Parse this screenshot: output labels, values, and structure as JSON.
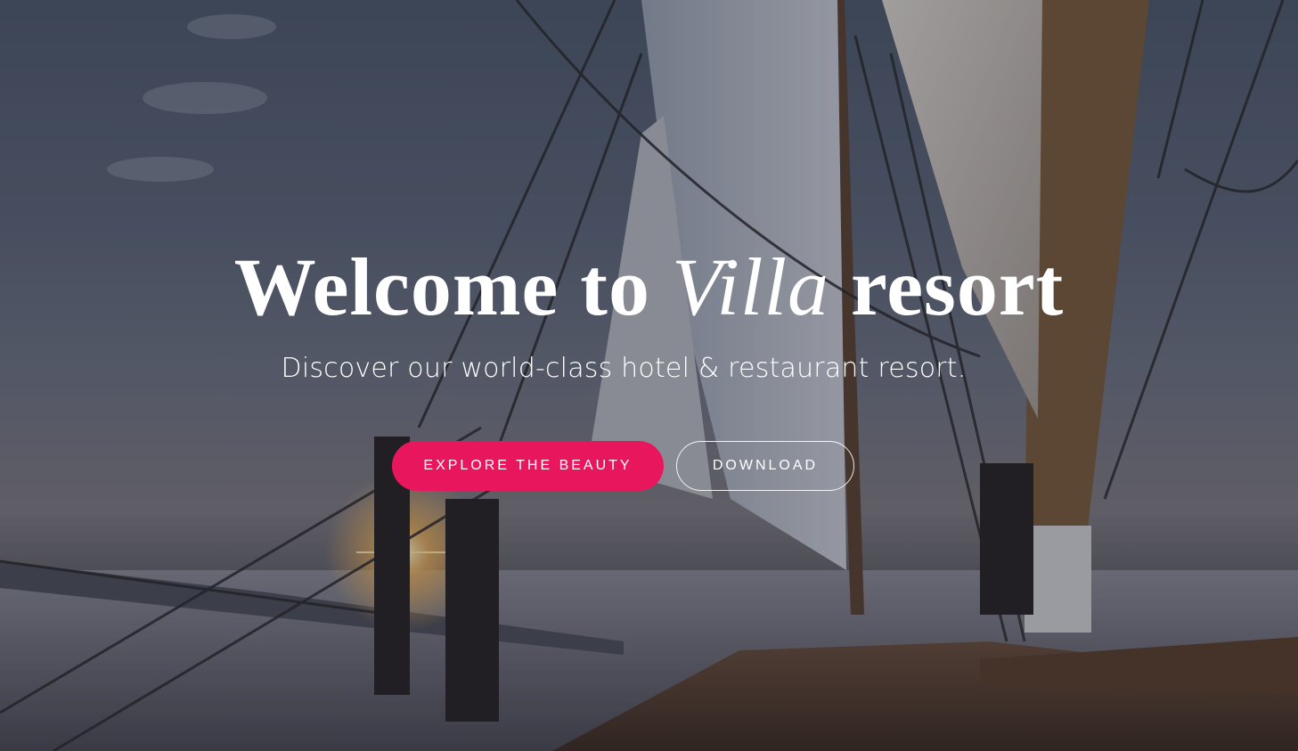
{
  "hero": {
    "title_pre": "Welcome to",
    "title_em": "Villa",
    "title_post": "resort",
    "subtitle": "Discover our world-class hotel & restaurant resort."
  },
  "buttons": {
    "primary_label": "EXPLORE THE BEAUTY",
    "secondary_label": "DOWNLOAD"
  },
  "colors": {
    "accent": "#e8175d",
    "text": "#ffffff"
  }
}
